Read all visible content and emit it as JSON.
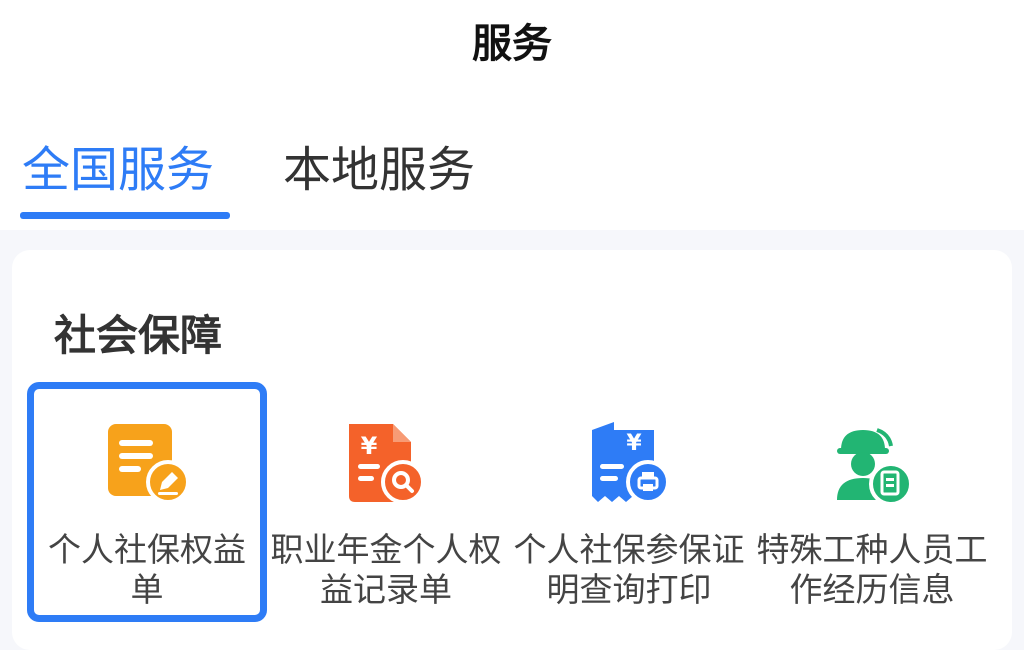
{
  "header": {
    "title": "服务"
  },
  "tabs": [
    {
      "label": "全国服务",
      "active": true
    },
    {
      "label": "本地服务",
      "active": false
    }
  ],
  "section": {
    "title": "社会保障",
    "items": [
      {
        "label": "个人社保权益单",
        "icon": "document-edit-icon",
        "color": "#f7a21b",
        "selected": true
      },
      {
        "label": "职业年金个人权益记录单",
        "icon": "yuan-document-search-icon",
        "color": "#f4622a",
        "selected": false
      },
      {
        "label": "个人社保参保证明查询打印",
        "icon": "yuan-receipt-print-icon",
        "color": "#2e7cf6",
        "selected": false
      },
      {
        "label": "特殊工种人员工作经历信息",
        "icon": "worker-document-icon",
        "color": "#22b573",
        "selected": false
      }
    ]
  },
  "colors": {
    "accent": "#2e7cf6",
    "background": "#f6f7fb"
  }
}
